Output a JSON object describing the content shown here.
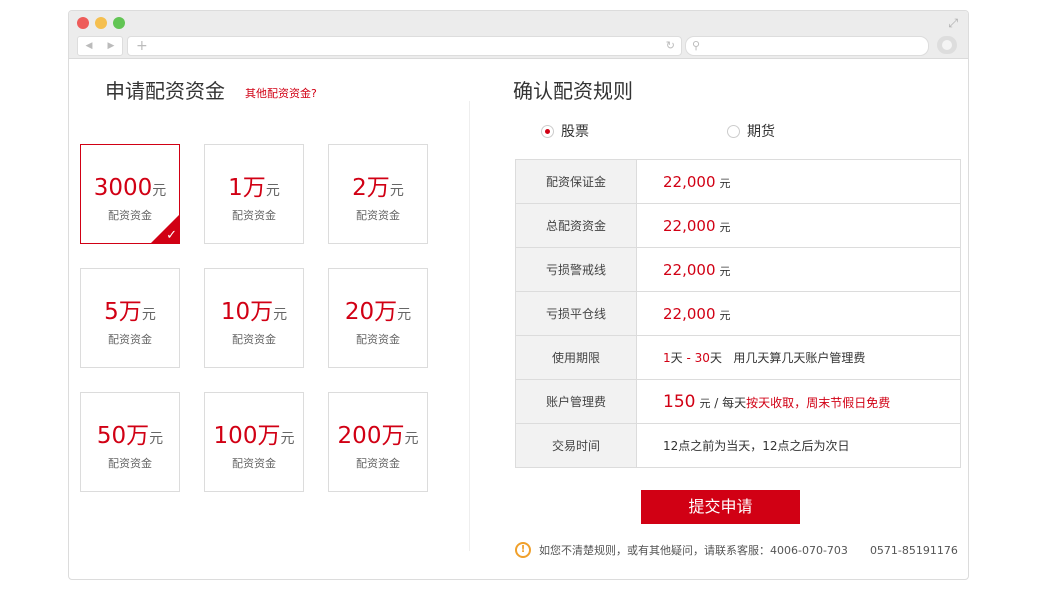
{
  "left": {
    "title": "申请配资资金",
    "other_link": "其他配资资金?",
    "cards": [
      {
        "amount": "3000",
        "unit": "元",
        "label": "配资资金",
        "selected": true
      },
      {
        "amount": "1万",
        "unit": "元",
        "label": "配资资金"
      },
      {
        "amount": "2万",
        "unit": "元",
        "label": "配资资金"
      },
      {
        "amount": "5万",
        "unit": "元",
        "label": "配资资金"
      },
      {
        "amount": "10万",
        "unit": "元",
        "label": "配资资金"
      },
      {
        "amount": "20万",
        "unit": "元",
        "label": "配资资金"
      },
      {
        "amount": "50万",
        "unit": "元",
        "label": "配资资金"
      },
      {
        "amount": "100万",
        "unit": "元",
        "label": "配资资金"
      },
      {
        "amount": "200万",
        "unit": "元",
        "label": "配资资金"
      }
    ]
  },
  "right": {
    "title": "确认配资规则",
    "radio_stock": "股票",
    "radio_futures": "期货",
    "rows": [
      {
        "label": "配资保证金",
        "value": "22,000",
        "unit": "元"
      },
      {
        "label": "总配资资金",
        "value": "22,000",
        "unit": "元"
      },
      {
        "label": "亏损警戒线",
        "value": "22,000",
        "unit": "元"
      },
      {
        "label": "亏损平仓线",
        "value": "22,000",
        "unit": "元"
      }
    ],
    "period": {
      "label": "使用期限",
      "from": "1",
      "day1": "天",
      "dash": "-",
      "to": "30",
      "day2": "天",
      "note": "用几天算几天账户管理费"
    },
    "fee": {
      "label": "账户管理费",
      "value": "150",
      "unit": "元",
      "sep": "/",
      "per_day": "每天",
      "red1": "按天收取",
      "comma": "，",
      "red2": "周末节假日免费"
    },
    "trade": {
      "label": "交易时间",
      "value": "12点之前为当天，12点之后为次日"
    },
    "submit": "提交申请",
    "notice": "如您不清楚规则，或有其他疑问，请联系客服：",
    "phone1": "4006-070-703",
    "phone2": "0571-85191176"
  },
  "colors": {
    "accent": "#d10014",
    "warning": "#f0a02b"
  }
}
